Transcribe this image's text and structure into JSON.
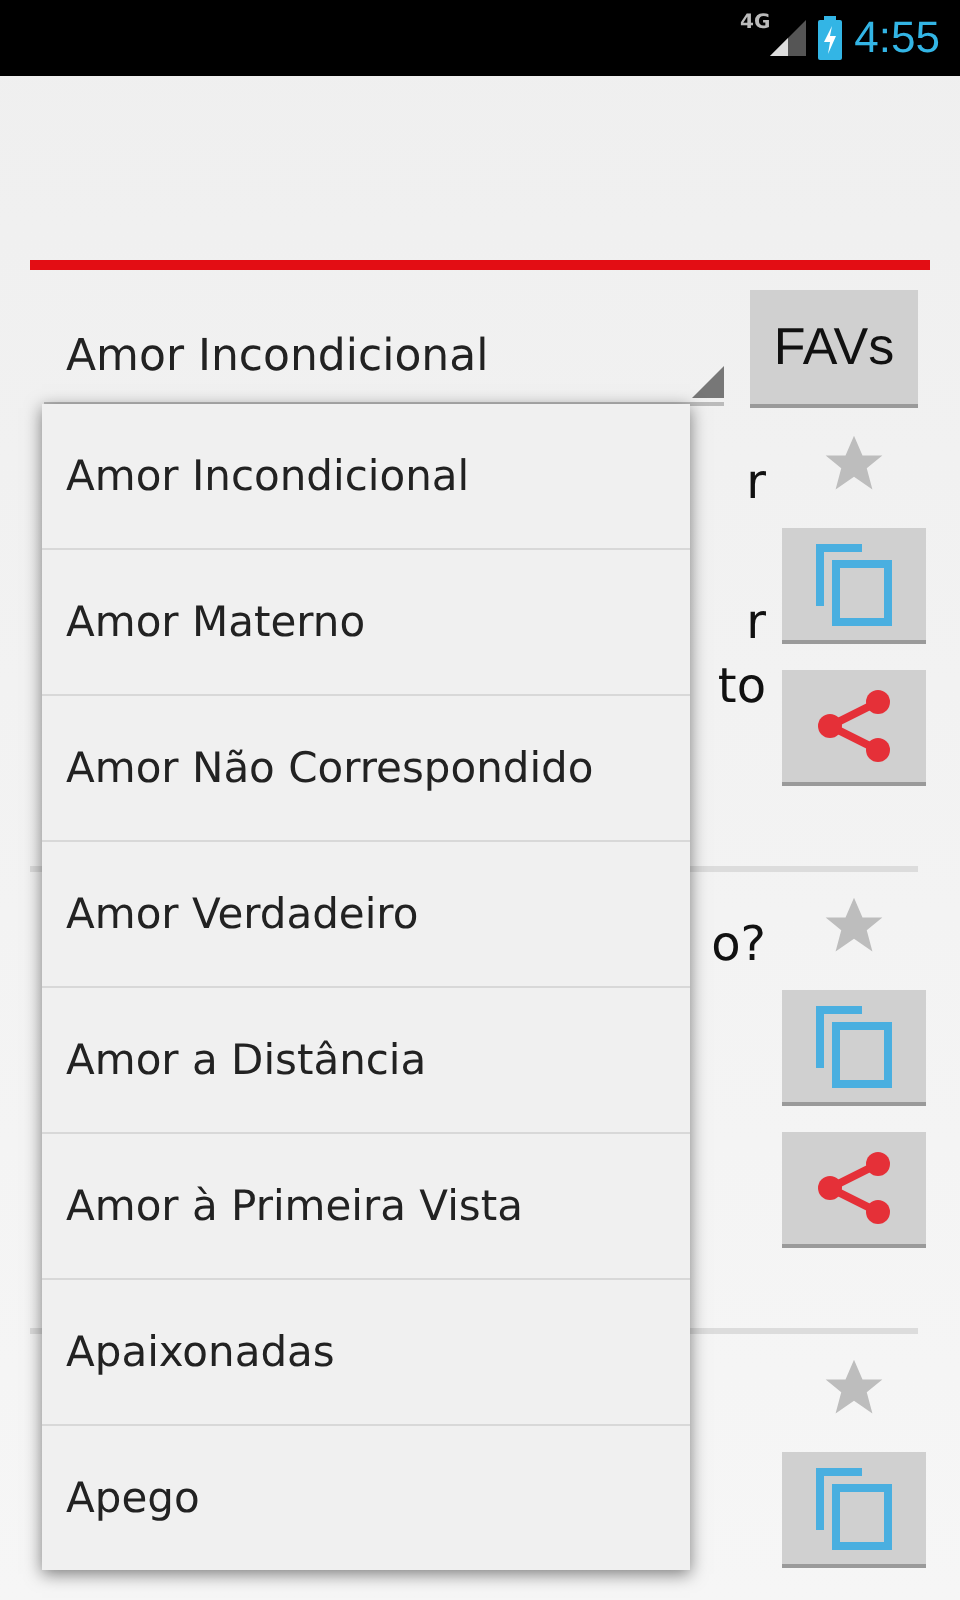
{
  "status_bar": {
    "network": "4G",
    "time": "4:55"
  },
  "category_spinner": {
    "value": "Amor Incondicional"
  },
  "favs_button": {
    "label": "FAVs"
  },
  "cards": [
    {
      "fragments": [
        {
          "text": "r"
        },
        {
          "text": "r"
        },
        {
          "text": "to"
        }
      ],
      "favorite": false,
      "actions": [
        {
          "kind": "copy"
        },
        {
          "kind": "share"
        }
      ]
    },
    {
      "fragments": [
        {
          "text": "o?"
        }
      ],
      "favorite": false,
      "actions": [
        {
          "kind": "copy"
        },
        {
          "kind": "share"
        }
      ]
    },
    {
      "favorite": false,
      "actions": [
        {
          "kind": "copy"
        }
      ]
    }
  ],
  "dropdown": {
    "items": [
      {
        "label": "Amor Incondicional"
      },
      {
        "label": "Amor Materno"
      },
      {
        "label": "Amor Não Correspondido"
      },
      {
        "label": "Amor Verdadeiro"
      },
      {
        "label": "Amor a Distância"
      },
      {
        "label": "Amor à Primeira Vista"
      },
      {
        "label": "Apaixonadas"
      },
      {
        "label": "Apego"
      }
    ]
  }
}
